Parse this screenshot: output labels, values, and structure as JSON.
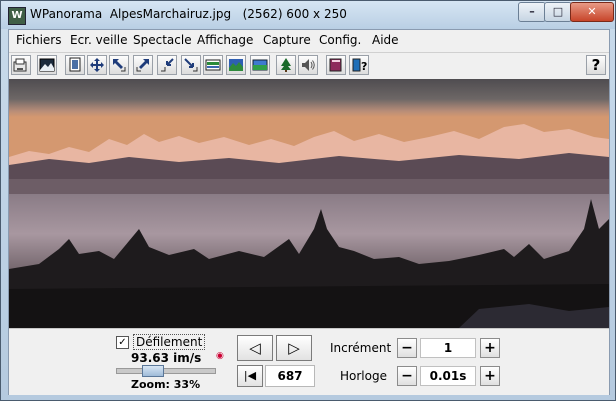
{
  "window": {
    "app_name": "WPanorama",
    "file_name": "AlpesMarchairuz.jpg",
    "dimensions": "(2562) 600 x 250",
    "app_icon_glyph": "W",
    "minimize_glyph": "–",
    "maximize_glyph": "□",
    "close_glyph": "✕"
  },
  "menu": [
    "Fichiers",
    "Ecr. veille",
    "Spectacle",
    "Affichage",
    "Capture",
    "Config.",
    "Aide"
  ],
  "toolbar": {
    "icons": [
      "open-file-icon",
      "image-icon",
      "copy-icon",
      "move-icon",
      "shrink-left-icon",
      "expand-right-icon",
      "shrink-diagonal-icon",
      "expand-diagonal-icon",
      "panorama-strip-icon",
      "landscape-icon",
      "horizon-icon",
      "tree-icon",
      "sound-icon",
      "book-icon",
      "help-book-icon"
    ],
    "help_label": "?"
  },
  "controls": {
    "scroll_label": "Défilement",
    "scroll_checked": true,
    "check_glyph": "✓",
    "speed": "93.63 im/s",
    "zoom": "Zoom: 33%",
    "zoom_fraction": 0.33,
    "prev_glyph": "◁",
    "next_glyph": "▷",
    "first_glyph": "|◀",
    "position": "687",
    "increment_label": "Incrément",
    "increment_value": "1",
    "clock_label": "Horloge",
    "clock_value": "0.01s",
    "minus": "−",
    "plus": "+"
  },
  "colors": {
    "sky_top": "#5d5a5d",
    "sky_glow": "#d49870",
    "mountain_lit": "#e8b6a2",
    "lake": "#9a8890",
    "forest": "#1e1b1d"
  }
}
